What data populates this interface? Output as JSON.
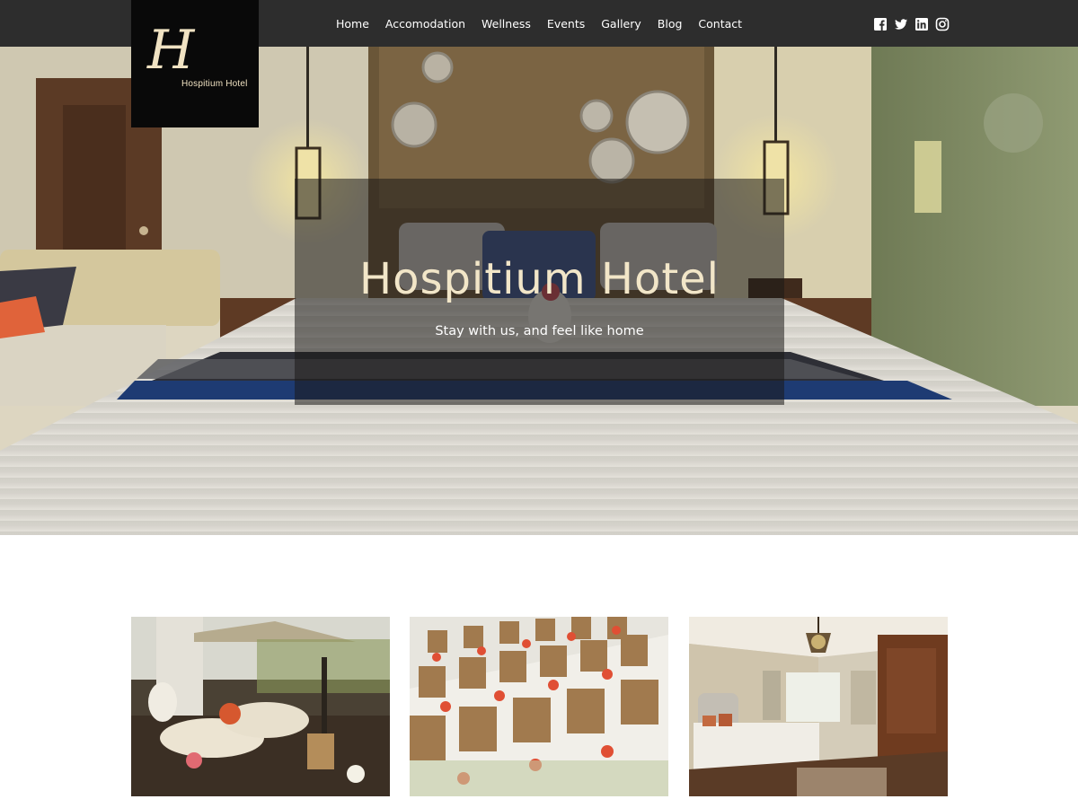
{
  "brand": {
    "logo_letter": "H",
    "logo_text": "Hospitium Hotel"
  },
  "nav": {
    "items": [
      {
        "label": "Home"
      },
      {
        "label": "Accomodation"
      },
      {
        "label": "Wellness"
      },
      {
        "label": "Events"
      },
      {
        "label": "Gallery"
      },
      {
        "label": "Blog"
      },
      {
        "label": "Contact"
      }
    ]
  },
  "social": [
    {
      "icon": "facebook-icon"
    },
    {
      "icon": "twitter-icon"
    },
    {
      "icon": "linkedin-icon"
    },
    {
      "icon": "instagram-icon"
    }
  ],
  "hero": {
    "title": "Hospitium Hotel",
    "tagline": "Stay with us, and feel like home"
  },
  "cards": [
    {
      "image": "spa-towels-image"
    },
    {
      "image": "banquet-hall-image"
    },
    {
      "image": "luxury-bedroom-image"
    }
  ],
  "colors": {
    "topbar": "#2d2d2d",
    "logo_bg": "#090909",
    "logo_text": "#f0e2c2",
    "hero_title": "#f2e6c8"
  }
}
